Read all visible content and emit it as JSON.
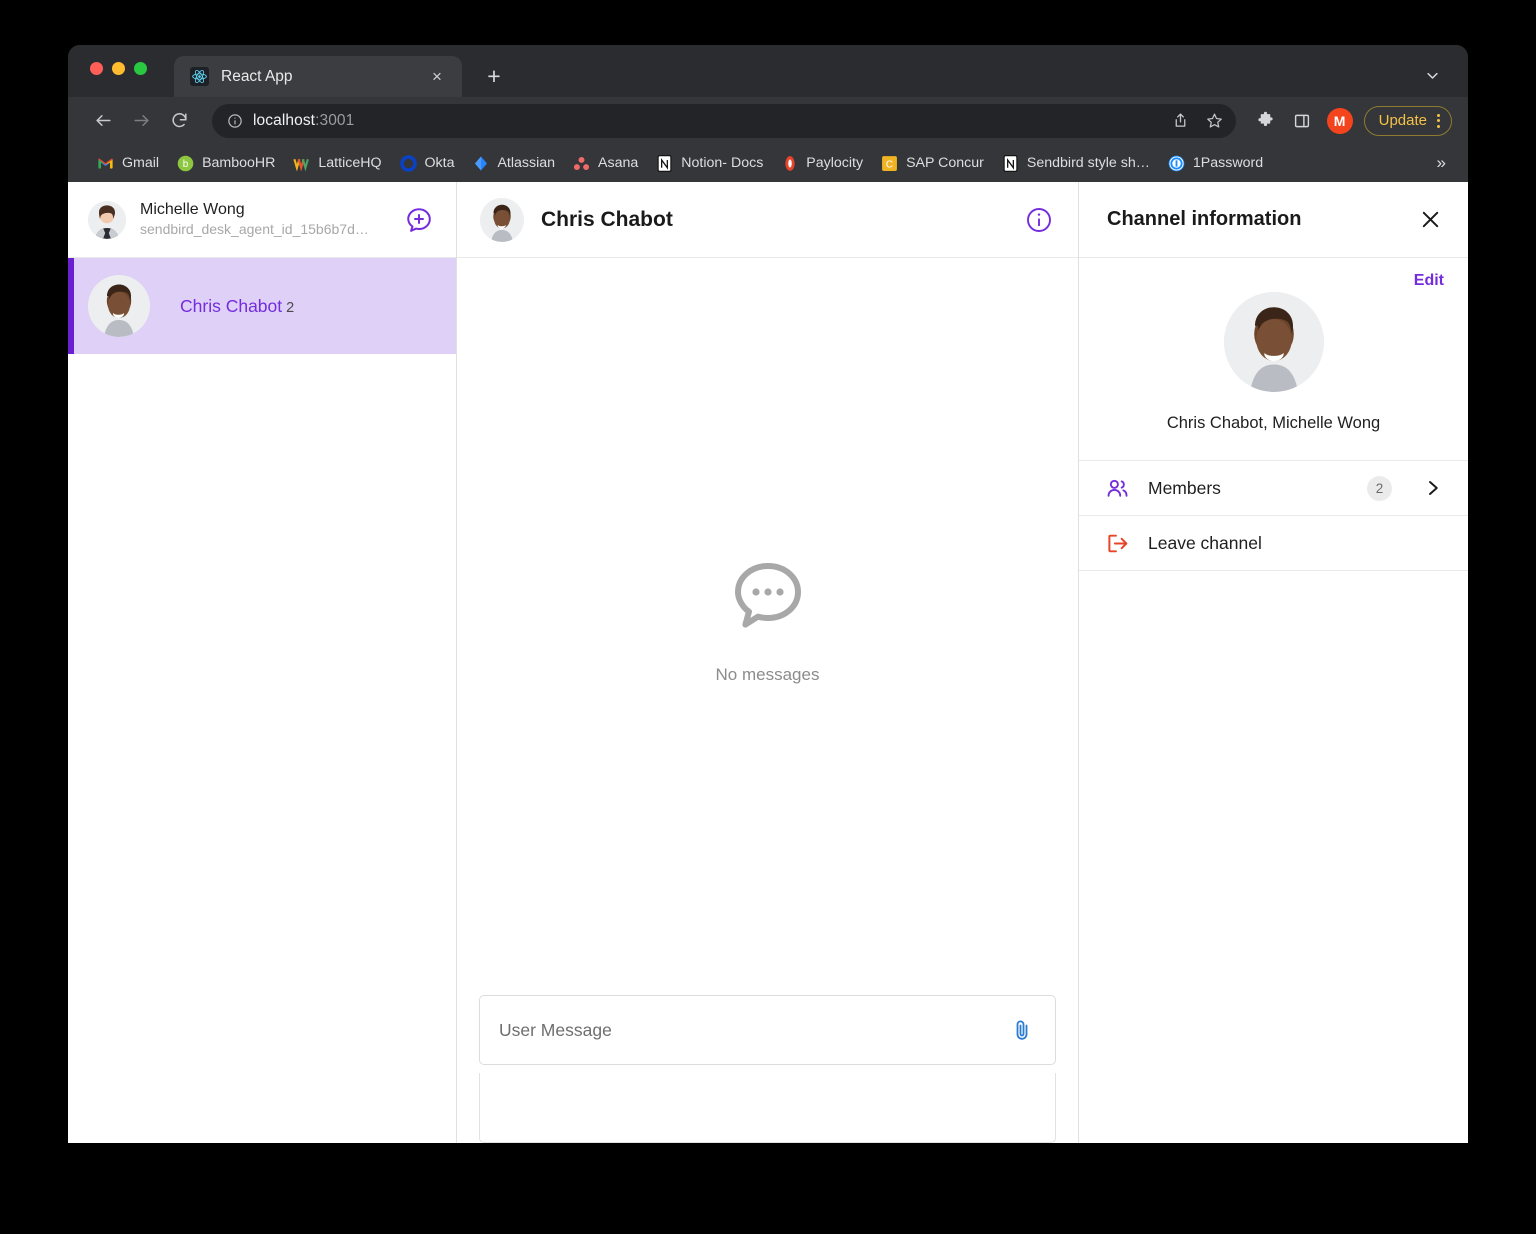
{
  "browser": {
    "tab": {
      "title": "React App",
      "favicon": "react-icon",
      "close": "×"
    },
    "new_tab_label": "+",
    "tab_list_chevron": "chevron-down-icon",
    "toolbar": {
      "back": "←",
      "forward": "→",
      "reload": "⟳",
      "url_main": "localhost",
      "url_port": ":3001",
      "share_icon": "share-icon",
      "bookmark_icon": "star-icon",
      "extensions_icon": "puzzle-icon",
      "sidepanel_icon": "side-panel-icon",
      "profile_initial": "M",
      "update_label": "Update"
    },
    "bookmarks": [
      {
        "label": "Gmail",
        "icon": "gmail-icon",
        "color": "#ea4335"
      },
      {
        "label": "BambooHR",
        "icon": "bamboohr-icon",
        "color": "#7ac143"
      },
      {
        "label": "LatticeHQ",
        "icon": "lattice-icon",
        "color": "#f2b41d"
      },
      {
        "label": "Okta",
        "icon": "okta-icon",
        "color": "#0a41c5"
      },
      {
        "label": "Atlassian",
        "icon": "atlassian-icon",
        "color": "#2684ff"
      },
      {
        "label": "Asana",
        "icon": "asana-icon",
        "color": "#f06a6a"
      },
      {
        "label": "Notion- Docs",
        "icon": "notion-icon",
        "color": "#ffffff"
      },
      {
        "label": "Paylocity",
        "icon": "paylocity-icon",
        "color": "#e8442a"
      },
      {
        "label": "SAP Concur",
        "icon": "sapconcur-icon",
        "color": "#f0b323"
      },
      {
        "label": "Sendbird style sh…",
        "icon": "notion-icon",
        "color": "#ffffff"
      },
      {
        "label": "1Password",
        "icon": "1password-icon",
        "color": "#1a8cff"
      }
    ],
    "bookmarks_overflow": "»"
  },
  "channel_list": {
    "current_user": {
      "name": "Michelle Wong",
      "id": "sendbird_desk_agent_id_15b6b7d…",
      "avatar": "michelle-avatar"
    },
    "add_channel_icon": "add-channel-icon",
    "items": [
      {
        "title": "Chris Chabot",
        "member_count": "2",
        "avatar": "chris-avatar",
        "selected": true
      }
    ]
  },
  "conversation": {
    "title": "Chris Chabot",
    "avatar": "chris-avatar",
    "info_icon": "info-icon",
    "empty_state": {
      "icon": "speech-bubble-icon",
      "label": "No messages"
    },
    "input": {
      "placeholder": "User Message",
      "attach_icon": "paperclip-icon"
    }
  },
  "info_panel": {
    "title": "Channel information",
    "close_icon": "close-icon",
    "edit_label": "Edit",
    "avatar": "chris-avatar",
    "members_summary": "Chris Chabot, Michelle Wong",
    "rows": [
      {
        "label": "Members",
        "icon": "members-icon",
        "badge": "2",
        "chevron": "chevron-right-icon"
      },
      {
        "label": "Leave channel",
        "icon": "leave-icon",
        "badge": "",
        "chevron": ""
      }
    ]
  },
  "theme": {
    "accent_purple": "#742ddd",
    "selected_bg": "#dfd0f8",
    "selected_bar": "#6a1fd0",
    "danger_red": "#e8442a",
    "link_blue": "#2b7cd3"
  }
}
